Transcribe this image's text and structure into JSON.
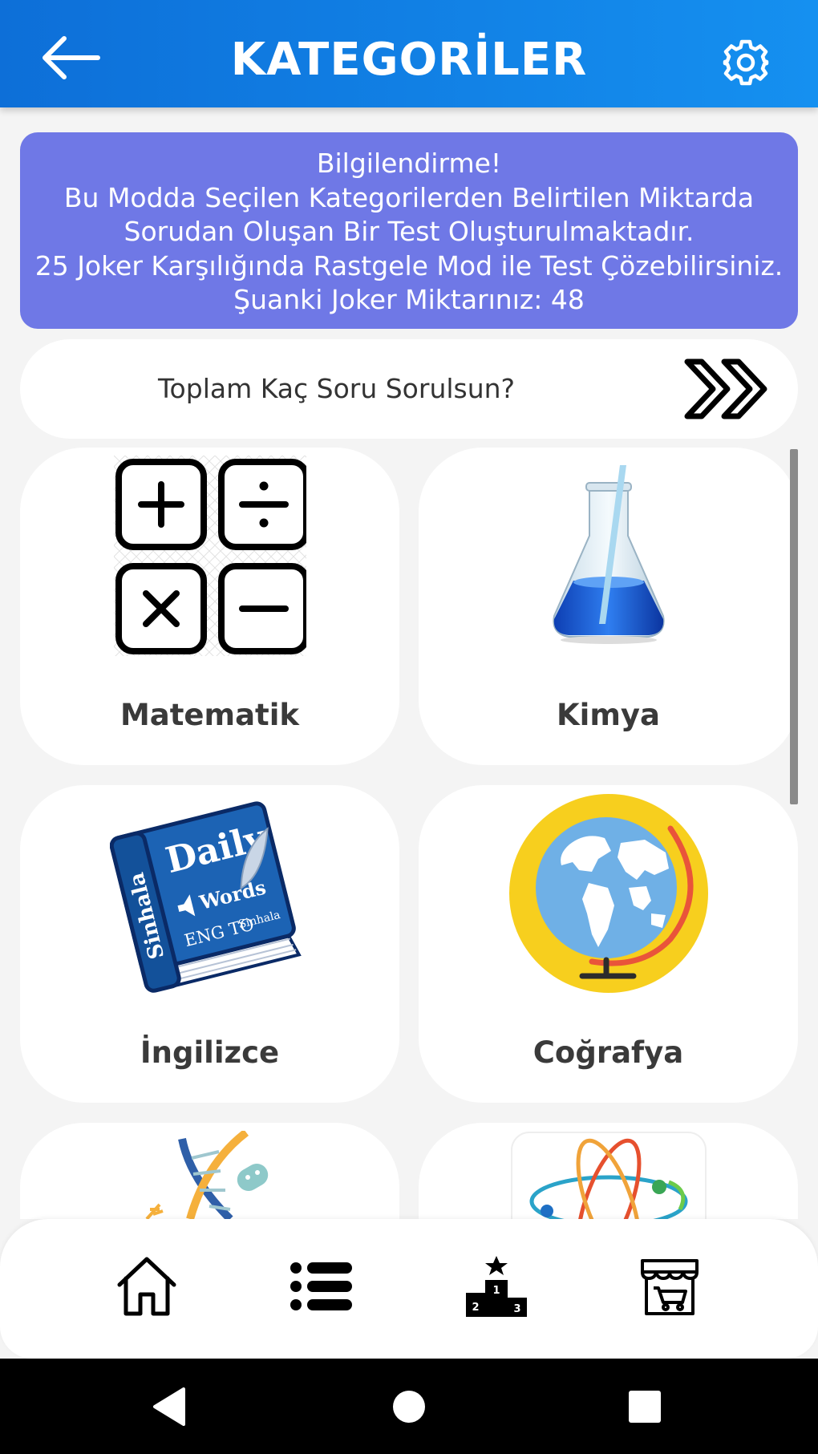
{
  "header": {
    "title": "KATEGORİLER",
    "back_icon": "back-arrow-icon",
    "settings_icon": "gear-icon",
    "background": "#1288ea"
  },
  "info": {
    "line1": "Bilgilendirme!",
    "line2": "Bu Modda Seçilen Kategorilerden Belirtilen Miktarda",
    "line3": "Sorudan Oluşan Bir Test Oluşturulmaktadır.",
    "line4": "25 Joker Karşılığında Rastgele Mod ile Test Çözebilirsiniz.",
    "line5": "Şuanki Joker Miktarınız: 48",
    "background": "#6f78e6"
  },
  "question_count": {
    "placeholder": "Toplam Kaç Soru Sorulsun?",
    "go_icon": "double-chevron-right-icon"
  },
  "categories": [
    {
      "label": "Matematik",
      "icon": "math-operators-icon"
    },
    {
      "label": "Kimya",
      "icon": "flask-icon"
    },
    {
      "label": "İngilizce",
      "icon": "dictionary-book-icon"
    },
    {
      "label": "Coğrafya",
      "icon": "globe-icon"
    },
    {
      "label": "",
      "icon": "dna-icon"
    },
    {
      "label": "",
      "icon": "atom-icon"
    }
  ],
  "book_art": {
    "title": "Daily",
    "subtitle": "Words",
    "spine": "Sinhala",
    "footer": "ENG TO",
    "footer_small": "Sinhala"
  },
  "bottom_nav": [
    "home-icon",
    "list-icon",
    "podium-icon",
    "store-icon"
  ],
  "podium_ranks": [
    "1",
    "2",
    "3"
  ],
  "system_nav": [
    "back-triangle-icon",
    "home-circle-icon",
    "recents-square-icon"
  ]
}
